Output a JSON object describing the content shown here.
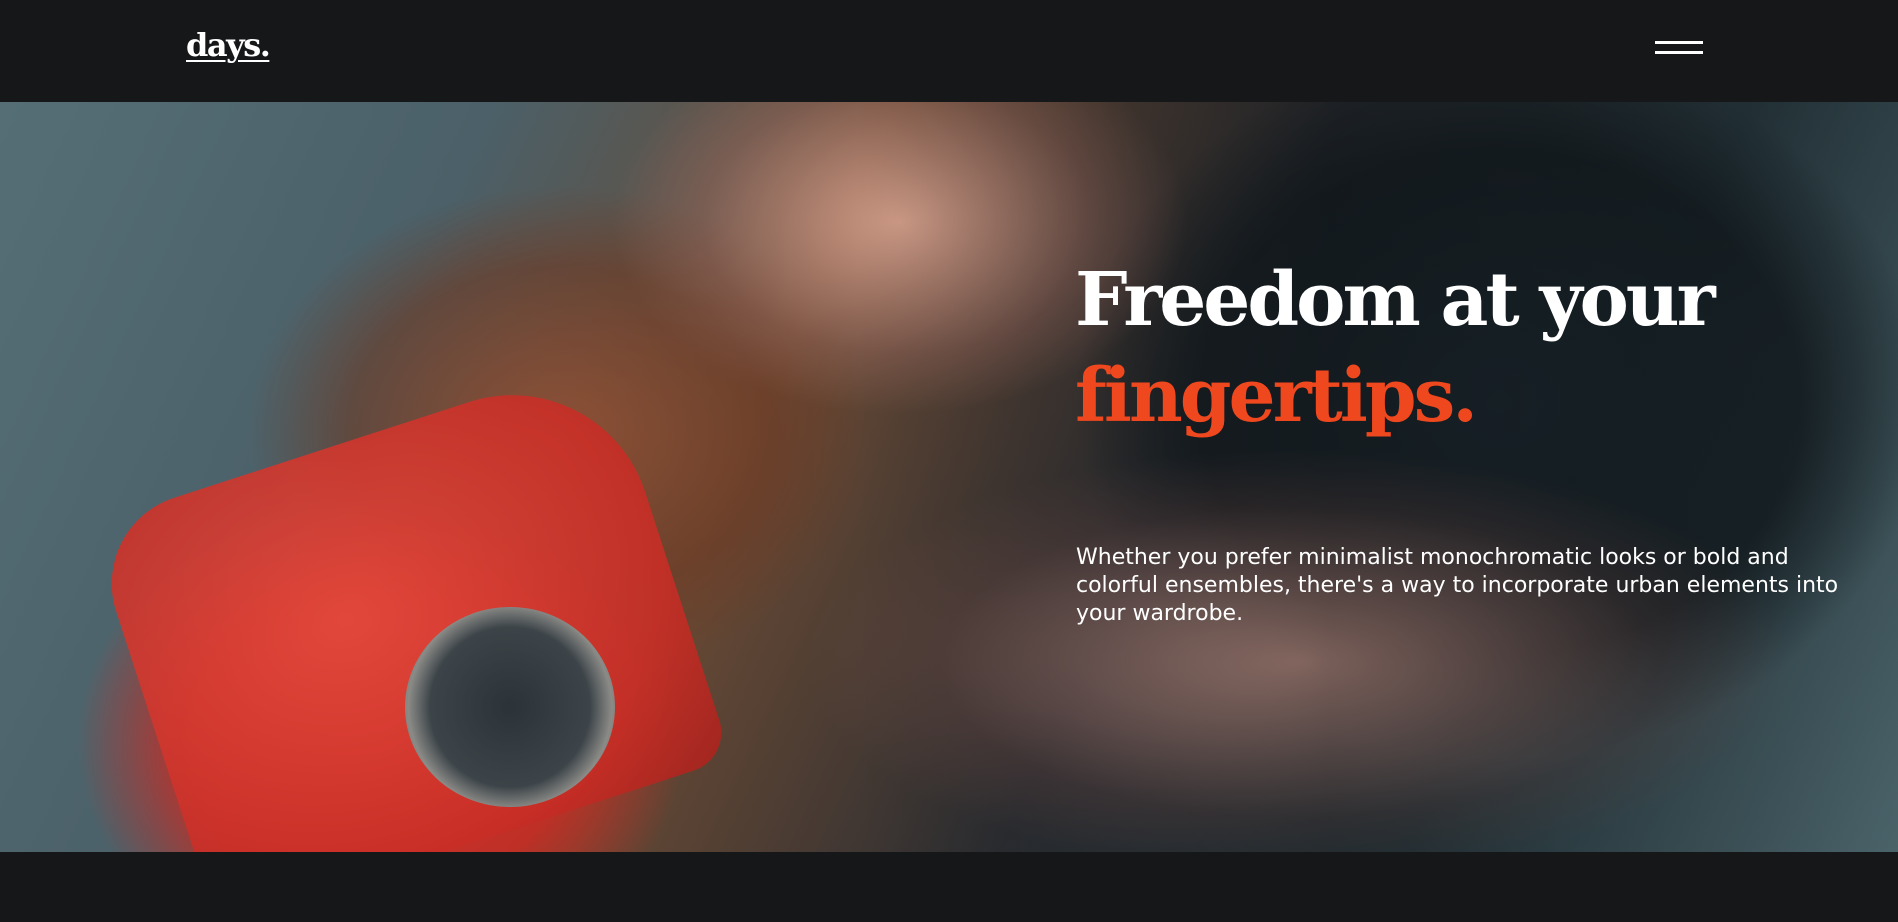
{
  "header": {
    "logo_text": "days.",
    "menu_icon": "hamburger-icon"
  },
  "hero": {
    "title_line1": "Freedom at your",
    "title_line2": "fingertips.",
    "description": "Whether you prefer minimalist monochromatic looks or bold and colorful ensembles, there's a way to incorporate urban elements into your wardrobe."
  },
  "colors": {
    "background": "#161719",
    "accent": "#f0481e",
    "text": "#ffffff"
  }
}
